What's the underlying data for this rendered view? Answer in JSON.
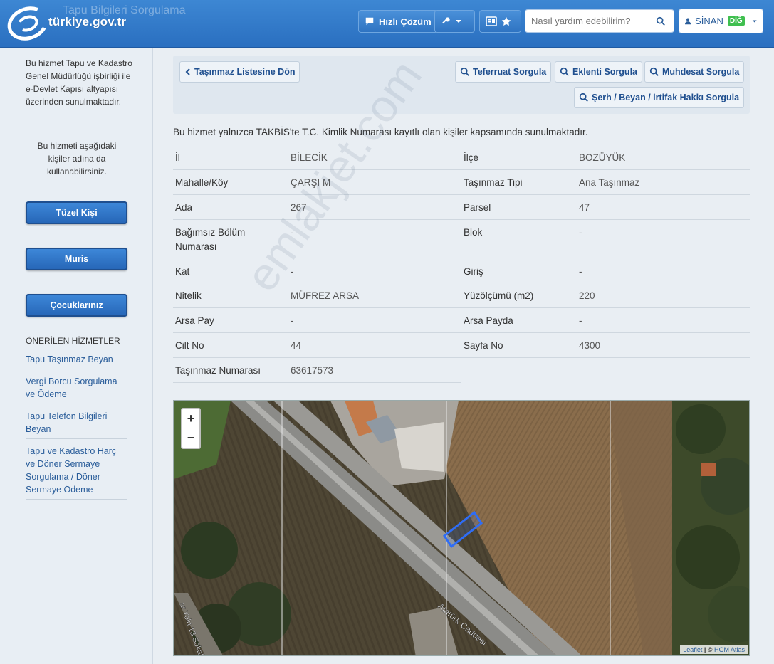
{
  "header": {
    "logo_text": "türkiye.gov.tr",
    "ghost_title": "Tapu Bilgileri Sorgulama",
    "quick_solution_label": "Hızlı Çözüm",
    "search_placeholder": "Nasıl yardım edebilirim?",
    "user_name": "SİNAN",
    "user_badge": "DİĞ"
  },
  "sidebar": {
    "note": "Bu hizmet Tapu ve Kadastro Genel Müdürlüğü işbirliği ile e-Devlet Kapısı altyapısı üzerinden sunulmaktadır.",
    "note2": "Bu hizmeti aşağıdaki kişiler adına da kullanabilirsiniz.",
    "buttons": [
      "Tüzel Kişi",
      "Muris",
      "Çocuklarınız"
    ],
    "suggested_heading": "ÖNERİLEN HİZMETLER",
    "suggested_links": [
      "Tapu Taşınmaz Beyan",
      "Vergi Borcu Sorgulama ve Ödeme",
      "Tapu Telefon Bilgileri Beyan",
      "Tapu ve Kadastro Harç ve Döner Sermaye Sorgulama / Döner Sermaye Ödeme"
    ]
  },
  "toolbar": {
    "back_label": "Taşınmaz Listesine Dön",
    "teferruat_label": "Teferruat Sorgula",
    "eklenti_label": "Eklenti Sorgula",
    "muhdesat_label": "Muhdesat Sorgula",
    "serh_label": "Şerh / Beyan / İrtifak Hakkı Sorgula"
  },
  "notice": "Bu hizmet yalnızca TAKBİS'te T.C. Kimlik Numarası kayıtlı olan kişiler kapsamında sunulmaktadır.",
  "info": {
    "il_label": "İl",
    "il_value": "BİLECİK",
    "ilce_label": "İlçe",
    "ilce_value": "BOZÜYÜK",
    "mahalle_label": "Mahalle/Köy",
    "mahalle_value": "ÇARŞI M",
    "tip_label": "Taşınmaz Tipi",
    "tip_value": "Ana Taşınmaz",
    "ada_label": "Ada",
    "ada_value": "267",
    "parsel_label": "Parsel",
    "parsel_value": "47",
    "bagimsiz_label": "Bağımsız Bölüm Numarası",
    "bagimsiz_value": "-",
    "blok_label": "Blok",
    "blok_value": "-",
    "kat_label": "Kat",
    "kat_value": "-",
    "giris_label": "Giriş",
    "giris_value": "-",
    "nitelik_label": "Nitelik",
    "nitelik_value": "MÜFREZ ARSA",
    "yuzolcumu_label": "Yüzölçümü (m2)",
    "yuzolcumu_value": "220",
    "arsapay_label": "Arsa Pay",
    "arsapay_value": "-",
    "arsapayda_label": "Arsa Payda",
    "arsapayda_value": "-",
    "cilt_label": "Cilt No",
    "cilt_value": "44",
    "sayfa_label": "Sayfa No",
    "sayfa_value": "4300",
    "tasinmazno_label": "Taşınmaz Numarası",
    "tasinmazno_value": "63617573"
  },
  "map": {
    "zoom_in": "+",
    "zoom_out": "−",
    "attribution_leaflet": "Leaflet",
    "attribution_sep": " | © ",
    "attribution_hgm": "HGM Atlas",
    "road_label_1": "Atatürk Caddesi",
    "road_label_2": "ar Yolu 13 Sokak"
  },
  "watermark": "emlakjet.com"
}
